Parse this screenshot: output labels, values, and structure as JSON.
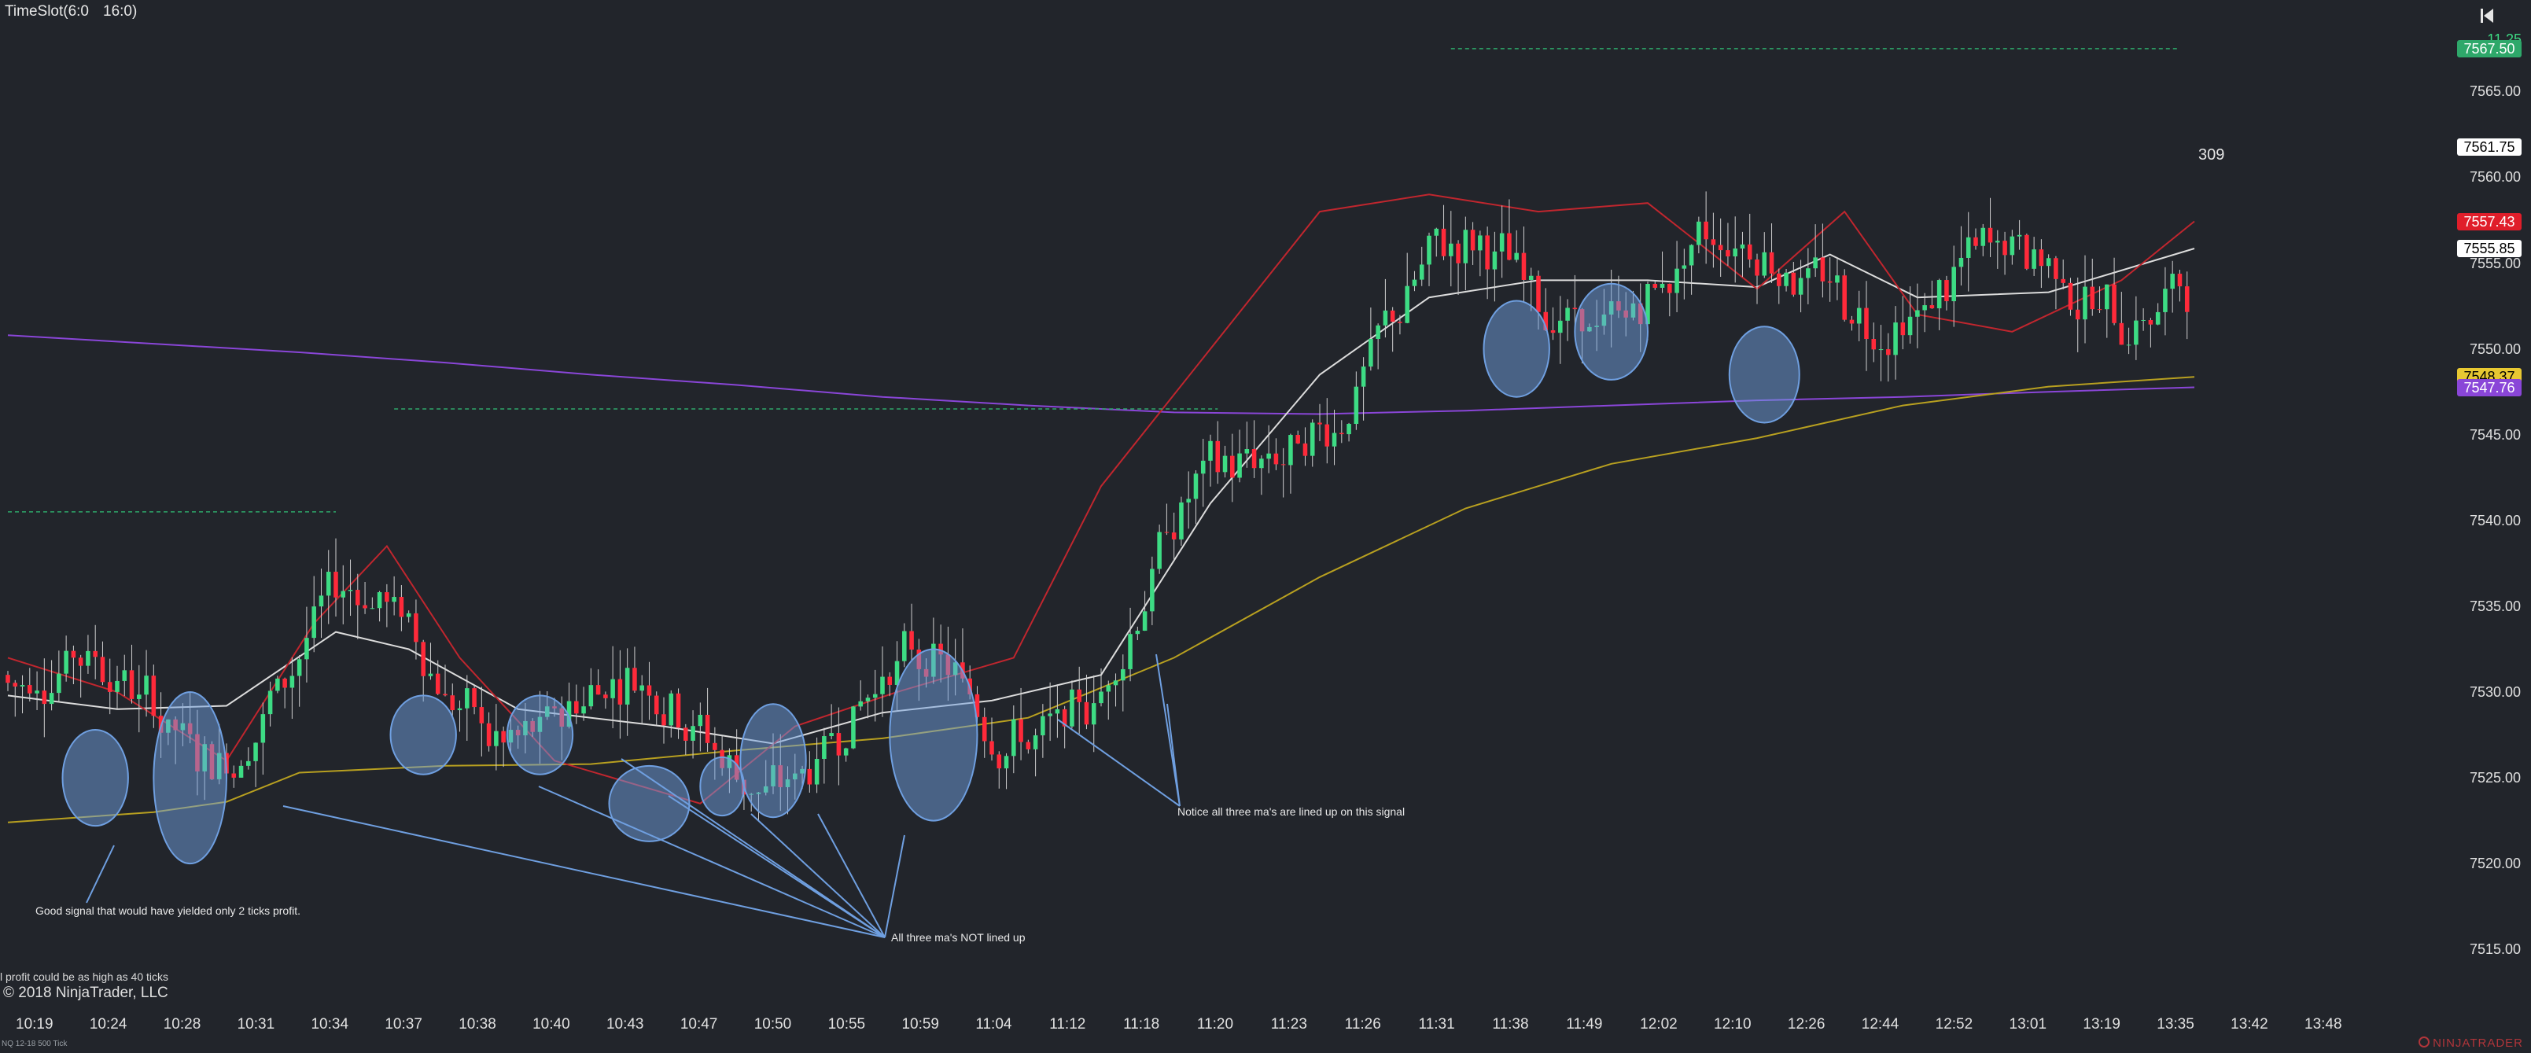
{
  "window": {
    "title": "TimeSlot(6:0",
    "slot": "16:0)",
    "bar_count_remaining": "11.25",
    "copyright": "© 2018 NinjaTrader, LLC",
    "note_small": "l profit could be as high as 40 ticks",
    "instrument": "NQ 12-18 500 Tick",
    "brand": "NINJATRADER",
    "volume_label": "309"
  },
  "colors": {
    "background": "#22252b",
    "up_candle": "#3ddc84",
    "down_candle": "#ff2a3a",
    "ma_fast": "#c0262e",
    "ma_mid": "#dcdcdc",
    "ma_slow_gold": "#b8a020",
    "ma_purple": "#8a46d8",
    "highlight_ellipse": "#6f9fe0",
    "arrow": "#6f9fe0",
    "level_line": "#2ea86a"
  },
  "chart_data": {
    "type": "candlestick",
    "y_axis": {
      "range": [
        7513.5,
        7568.5
      ],
      "ticks": [
        "7565.00",
        "7560.00",
        "7555.00",
        "7550.00",
        "7545.00",
        "7540.00",
        "7535.00",
        "7530.00",
        "7525.00",
        "7520.00",
        "7515.00"
      ]
    },
    "x_axis": {
      "ticks": [
        "10:19",
        "10:24",
        "10:28",
        "10:31",
        "10:34",
        "10:37",
        "10:38",
        "10:40",
        "10:43",
        "10:47",
        "10:50",
        "10:55",
        "10:59",
        "11:04",
        "11:12",
        "11:18",
        "11:20",
        "11:23",
        "11:26",
        "11:31",
        "11:38",
        "11:49",
        "12:02",
        "12:10",
        "12:26",
        "12:44",
        "12:52",
        "13:01",
        "13:19",
        "13:35",
        "13:42",
        "13:48"
      ]
    },
    "price_markers": [
      {
        "label": "7567.50",
        "value": 7567.5,
        "color": "#2ea86a",
        "text_color": "#ffffff"
      },
      {
        "label": "7561.75",
        "value": 7561.75,
        "color": "#ffffff",
        "text_color": "#000000"
      },
      {
        "label": "7557.43",
        "value": 7557.43,
        "color": "#e01e2a",
        "text_color": "#ffffff"
      },
      {
        "label": "7555.85",
        "value": 7555.85,
        "color": "#ffffff",
        "text_color": "#000000"
      },
      {
        "label": "7548.37",
        "value": 7548.37,
        "color": "#e8c832",
        "text_color": "#000000"
      },
      {
        "label": "7547.76",
        "value": 7547.76,
        "color": "#8a46d8",
        "text_color": "#ffffff"
      }
    ],
    "ma_series": [
      {
        "color": "#8a46d8",
        "points": [
          [
            0,
            7550.8
          ],
          [
            20,
            7550.3
          ],
          [
            40,
            7549.8
          ],
          [
            60,
            7549.2
          ],
          [
            80,
            7548.5
          ],
          [
            100,
            7547.9
          ],
          [
            120,
            7547.2
          ],
          [
            140,
            7546.7
          ],
          [
            160,
            7546.3
          ],
          [
            180,
            7546.2
          ],
          [
            200,
            7546.4
          ],
          [
            220,
            7546.7
          ],
          [
            240,
            7547.0
          ],
          [
            260,
            7547.2
          ],
          [
            280,
            7547.5
          ],
          [
            300,
            7547.76
          ]
        ]
      },
      {
        "color": "#b8a020",
        "points": [
          [
            0,
            7522.4
          ],
          [
            20,
            7523.0
          ],
          [
            30,
            7523.6
          ],
          [
            40,
            7525.3
          ],
          [
            60,
            7525.7
          ],
          [
            80,
            7525.8
          ],
          [
            100,
            7526.6
          ],
          [
            120,
            7527.3
          ],
          [
            140,
            7528.5
          ],
          [
            160,
            7532.0
          ],
          [
            180,
            7536.7
          ],
          [
            200,
            7540.7
          ],
          [
            220,
            7543.3
          ],
          [
            240,
            7544.8
          ],
          [
            260,
            7546.7
          ],
          [
            280,
            7547.8
          ],
          [
            300,
            7548.37
          ]
        ]
      },
      {
        "color": "#dcdcdc",
        "points": [
          [
            0,
            7529.8
          ],
          [
            15,
            7529.0
          ],
          [
            30,
            7529.2
          ],
          [
            45,
            7533.5
          ],
          [
            55,
            7532.5
          ],
          [
            70,
            7529.0
          ],
          [
            90,
            7528.0
          ],
          [
            105,
            7527.0
          ],
          [
            120,
            7528.8
          ],
          [
            135,
            7529.5
          ],
          [
            150,
            7531.0
          ],
          [
            165,
            7541.0
          ],
          [
            180,
            7548.5
          ],
          [
            195,
            7553.0
          ],
          [
            210,
            7554.0
          ],
          [
            225,
            7554.0
          ],
          [
            240,
            7553.6
          ],
          [
            250,
            7555.5
          ],
          [
            262,
            7553.0
          ],
          [
            280,
            7553.3
          ],
          [
            300,
            7555.85
          ]
        ]
      },
      {
        "color": "#c0262e",
        "points": [
          [
            0,
            7532.0
          ],
          [
            15,
            7530.0
          ],
          [
            30,
            7526.0
          ],
          [
            42,
            7534.0
          ],
          [
            52,
            7538.5
          ],
          [
            62,
            7532.0
          ],
          [
            75,
            7526.0
          ],
          [
            95,
            7523.5
          ],
          [
            108,
            7528.0
          ],
          [
            122,
            7530.0
          ],
          [
            138,
            7532.0
          ],
          [
            150,
            7542.0
          ],
          [
            165,
            7550.0
          ],
          [
            180,
            7558.0
          ],
          [
            195,
            7559.0
          ],
          [
            210,
            7558.0
          ],
          [
            225,
            7558.5
          ],
          [
            240,
            7553.5
          ],
          [
            252,
            7558.0
          ],
          [
            262,
            7552.0
          ],
          [
            275,
            7551.0
          ],
          [
            290,
            7554.0
          ],
          [
            300,
            7557.43
          ]
        ]
      }
    ],
    "candles_count": 300,
    "annotations": {
      "good_signal": "Good signal that would have yielded only 2 ticks profit.",
      "not_lined_up": "All three ma's NOT lined up",
      "lined_up": "Notice all three ma's are lined up on this signal"
    },
    "highlight_ellipses": [
      {
        "bar": 12,
        "price": 7525.0,
        "rx_bars": 4.5,
        "ry_price": 2.8
      },
      {
        "bar": 25,
        "price": 7525.0,
        "rx_bars": 5,
        "ry_price": 5.0
      },
      {
        "bar": 57,
        "price": 7527.5,
        "rx_bars": 4.5,
        "ry_price": 2.3
      },
      {
        "bar": 73,
        "price": 7527.5,
        "rx_bars": 4.5,
        "ry_price": 2.3
      },
      {
        "bar": 88,
        "price": 7523.5,
        "rx_bars": 5.5,
        "ry_price": 2.2
      },
      {
        "bar": 98,
        "price": 7524.5,
        "rx_bars": 3,
        "ry_price": 1.7
      },
      {
        "bar": 105,
        "price": 7526.0,
        "rx_bars": 4.5,
        "ry_price": 3.3
      },
      {
        "bar": 127,
        "price": 7527.5,
        "rx_bars": 6,
        "ry_price": 5.0
      },
      {
        "bar": 207,
        "price": 7550.0,
        "rx_bars": 4.5,
        "ry_price": 2.8
      },
      {
        "bar": 220,
        "price": 7551.0,
        "rx_bars": 5,
        "ry_price": 2.8
      },
      {
        "bar": 241,
        "price": 7548.5,
        "rx_bars": 4.8,
        "ry_price": 2.8
      }
    ]
  }
}
